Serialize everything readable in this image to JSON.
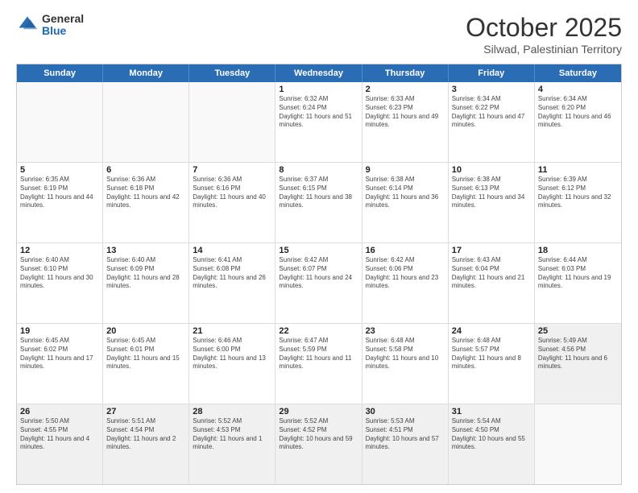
{
  "header": {
    "logo_general": "General",
    "logo_blue": "Blue",
    "month_title": "October 2025",
    "subtitle": "Silwad, Palestinian Territory"
  },
  "days_of_week": [
    "Sunday",
    "Monday",
    "Tuesday",
    "Wednesday",
    "Thursday",
    "Friday",
    "Saturday"
  ],
  "rows": [
    [
      {
        "day": "",
        "empty": true
      },
      {
        "day": "",
        "empty": true
      },
      {
        "day": "",
        "empty": true
      },
      {
        "day": "1",
        "sunrise": "Sunrise: 6:32 AM",
        "sunset": "Sunset: 6:24 PM",
        "daylight": "Daylight: 11 hours and 51 minutes."
      },
      {
        "day": "2",
        "sunrise": "Sunrise: 6:33 AM",
        "sunset": "Sunset: 6:23 PM",
        "daylight": "Daylight: 11 hours and 49 minutes."
      },
      {
        "day": "3",
        "sunrise": "Sunrise: 6:34 AM",
        "sunset": "Sunset: 6:22 PM",
        "daylight": "Daylight: 11 hours and 47 minutes."
      },
      {
        "day": "4",
        "sunrise": "Sunrise: 6:34 AM",
        "sunset": "Sunset: 6:20 PM",
        "daylight": "Daylight: 11 hours and 46 minutes."
      }
    ],
    [
      {
        "day": "5",
        "sunrise": "Sunrise: 6:35 AM",
        "sunset": "Sunset: 6:19 PM",
        "daylight": "Daylight: 11 hours and 44 minutes."
      },
      {
        "day": "6",
        "sunrise": "Sunrise: 6:36 AM",
        "sunset": "Sunset: 6:18 PM",
        "daylight": "Daylight: 11 hours and 42 minutes."
      },
      {
        "day": "7",
        "sunrise": "Sunrise: 6:36 AM",
        "sunset": "Sunset: 6:16 PM",
        "daylight": "Daylight: 11 hours and 40 minutes."
      },
      {
        "day": "8",
        "sunrise": "Sunrise: 6:37 AM",
        "sunset": "Sunset: 6:15 PM",
        "daylight": "Daylight: 11 hours and 38 minutes."
      },
      {
        "day": "9",
        "sunrise": "Sunrise: 6:38 AM",
        "sunset": "Sunset: 6:14 PM",
        "daylight": "Daylight: 11 hours and 36 minutes."
      },
      {
        "day": "10",
        "sunrise": "Sunrise: 6:38 AM",
        "sunset": "Sunset: 6:13 PM",
        "daylight": "Daylight: 11 hours and 34 minutes."
      },
      {
        "day": "11",
        "sunrise": "Sunrise: 6:39 AM",
        "sunset": "Sunset: 6:12 PM",
        "daylight": "Daylight: 11 hours and 32 minutes."
      }
    ],
    [
      {
        "day": "12",
        "sunrise": "Sunrise: 6:40 AM",
        "sunset": "Sunset: 6:10 PM",
        "daylight": "Daylight: 11 hours and 30 minutes."
      },
      {
        "day": "13",
        "sunrise": "Sunrise: 6:40 AM",
        "sunset": "Sunset: 6:09 PM",
        "daylight": "Daylight: 11 hours and 28 minutes."
      },
      {
        "day": "14",
        "sunrise": "Sunrise: 6:41 AM",
        "sunset": "Sunset: 6:08 PM",
        "daylight": "Daylight: 11 hours and 26 minutes."
      },
      {
        "day": "15",
        "sunrise": "Sunrise: 6:42 AM",
        "sunset": "Sunset: 6:07 PM",
        "daylight": "Daylight: 11 hours and 24 minutes."
      },
      {
        "day": "16",
        "sunrise": "Sunrise: 6:42 AM",
        "sunset": "Sunset: 6:06 PM",
        "daylight": "Daylight: 11 hours and 23 minutes."
      },
      {
        "day": "17",
        "sunrise": "Sunrise: 6:43 AM",
        "sunset": "Sunset: 6:04 PM",
        "daylight": "Daylight: 11 hours and 21 minutes."
      },
      {
        "day": "18",
        "sunrise": "Sunrise: 6:44 AM",
        "sunset": "Sunset: 6:03 PM",
        "daylight": "Daylight: 11 hours and 19 minutes."
      }
    ],
    [
      {
        "day": "19",
        "sunrise": "Sunrise: 6:45 AM",
        "sunset": "Sunset: 6:02 PM",
        "daylight": "Daylight: 11 hours and 17 minutes."
      },
      {
        "day": "20",
        "sunrise": "Sunrise: 6:45 AM",
        "sunset": "Sunset: 6:01 PM",
        "daylight": "Daylight: 11 hours and 15 minutes."
      },
      {
        "day": "21",
        "sunrise": "Sunrise: 6:46 AM",
        "sunset": "Sunset: 6:00 PM",
        "daylight": "Daylight: 11 hours and 13 minutes."
      },
      {
        "day": "22",
        "sunrise": "Sunrise: 6:47 AM",
        "sunset": "Sunset: 5:59 PM",
        "daylight": "Daylight: 11 hours and 11 minutes."
      },
      {
        "day": "23",
        "sunrise": "Sunrise: 6:48 AM",
        "sunset": "Sunset: 5:58 PM",
        "daylight": "Daylight: 11 hours and 10 minutes."
      },
      {
        "day": "24",
        "sunrise": "Sunrise: 6:48 AM",
        "sunset": "Sunset: 5:57 PM",
        "daylight": "Daylight: 11 hours and 8 minutes."
      },
      {
        "day": "25",
        "sunrise": "Sunrise: 5:49 AM",
        "sunset": "Sunset: 4:56 PM",
        "daylight": "Daylight: 11 hours and 6 minutes.",
        "shaded": true
      }
    ],
    [
      {
        "day": "26",
        "sunrise": "Sunrise: 5:50 AM",
        "sunset": "Sunset: 4:55 PM",
        "daylight": "Daylight: 11 hours and 4 minutes.",
        "shaded": true
      },
      {
        "day": "27",
        "sunrise": "Sunrise: 5:51 AM",
        "sunset": "Sunset: 4:54 PM",
        "daylight": "Daylight: 11 hours and 2 minutes.",
        "shaded": true
      },
      {
        "day": "28",
        "sunrise": "Sunrise: 5:52 AM",
        "sunset": "Sunset: 4:53 PM",
        "daylight": "Daylight: 11 hours and 1 minute.",
        "shaded": true
      },
      {
        "day": "29",
        "sunrise": "Sunrise: 5:52 AM",
        "sunset": "Sunset: 4:52 PM",
        "daylight": "Daylight: 10 hours and 59 minutes.",
        "shaded": true
      },
      {
        "day": "30",
        "sunrise": "Sunrise: 5:53 AM",
        "sunset": "Sunset: 4:51 PM",
        "daylight": "Daylight: 10 hours and 57 minutes.",
        "shaded": true
      },
      {
        "day": "31",
        "sunrise": "Sunrise: 5:54 AM",
        "sunset": "Sunset: 4:50 PM",
        "daylight": "Daylight: 10 hours and 55 minutes.",
        "shaded": true
      },
      {
        "day": "",
        "empty": true
      }
    ]
  ]
}
